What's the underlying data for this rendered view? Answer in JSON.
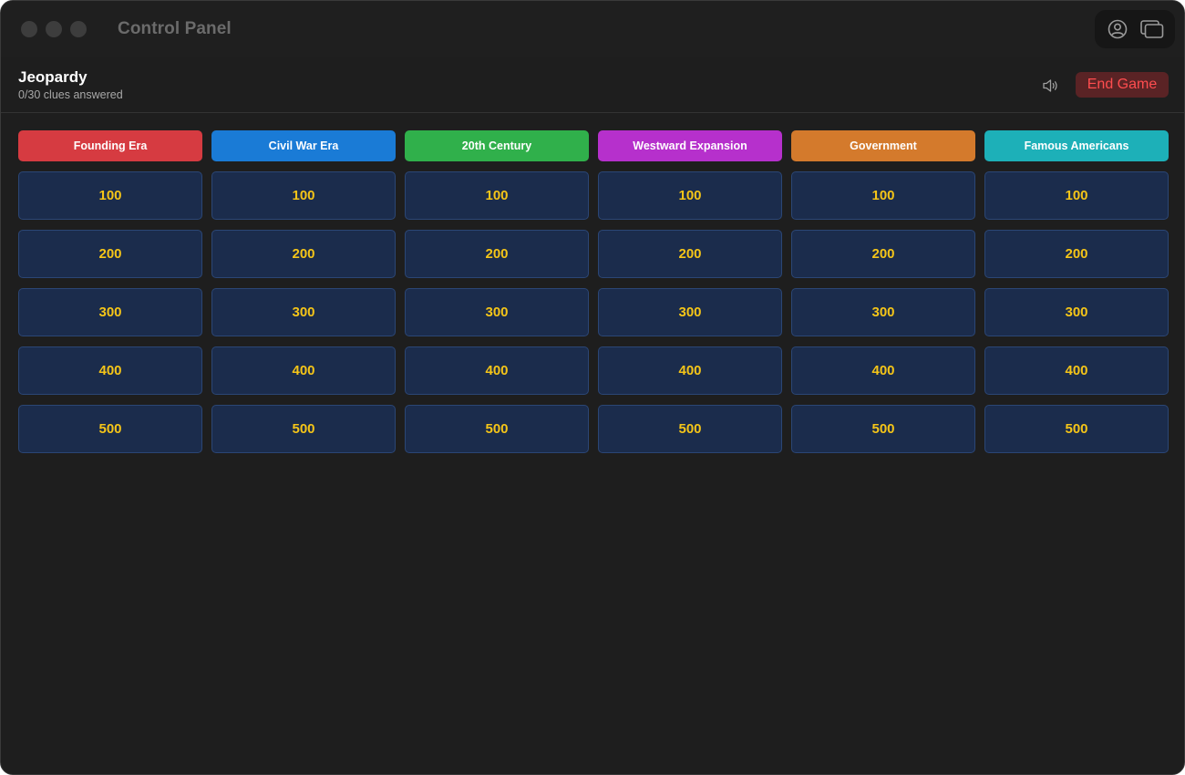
{
  "window": {
    "title": "Control Panel"
  },
  "title_tools": {
    "profile_icon": "person-circle-icon",
    "windows_icon": "window-stack-icon"
  },
  "game": {
    "title": "Jeopardy",
    "progress": "0/30 clues answered",
    "end_label": "End Game",
    "sound_icon": "speaker-icon"
  },
  "colors": {
    "window_bg": "#1e1e1e",
    "cell_bg": "#1b2c4c",
    "cell_value": "#f5c518",
    "end_text": "#ff4d4f"
  },
  "board": {
    "categories": [
      {
        "name": "Founding Era",
        "color": "#d63b41",
        "values": [
          "100",
          "200",
          "300",
          "400",
          "500"
        ]
      },
      {
        "name": "Civil War Era",
        "color": "#1a7bd6",
        "values": [
          "100",
          "200",
          "300",
          "400",
          "500"
        ]
      },
      {
        "name": "20th Century",
        "color": "#30b04b",
        "values": [
          "100",
          "200",
          "300",
          "400",
          "500"
        ]
      },
      {
        "name": "Westward Expansion",
        "color": "#b630cc",
        "values": [
          "100",
          "200",
          "300",
          "400",
          "500"
        ]
      },
      {
        "name": "Government",
        "color": "#d47a2c",
        "values": [
          "100",
          "200",
          "300",
          "400",
          "500"
        ]
      },
      {
        "name": "Famous Americans",
        "color": "#1db0b8",
        "values": [
          "100",
          "200",
          "300",
          "400",
          "500"
        ]
      }
    ]
  }
}
